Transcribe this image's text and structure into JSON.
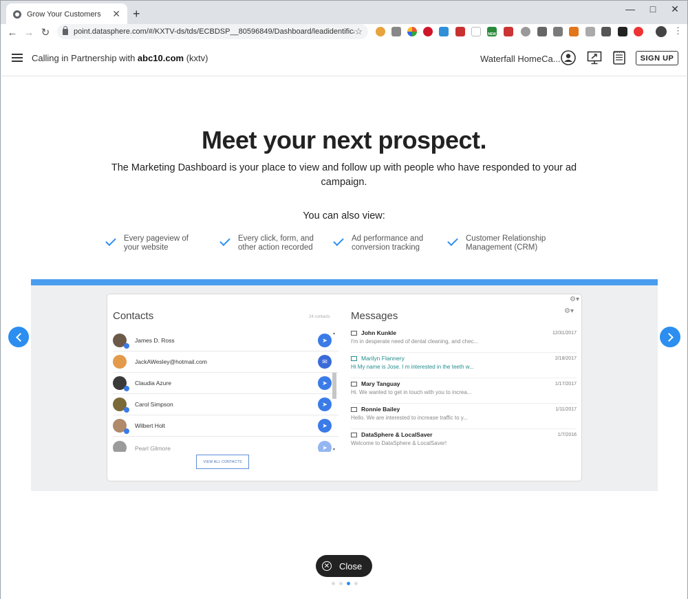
{
  "browser": {
    "tab_title": "Grow Your Customers",
    "tab_close": "✕",
    "new_tab": "+",
    "url": "point.datasphere.com/#/KXTV-ds/tds/ECBDSP__80596849/Dashboard/leadidentification",
    "extension_badge_new": "NEW"
  },
  "header": {
    "calling_prefix": "Calling in Partnership with ",
    "partner_bold": "abc10.com",
    "partner_suffix": " (kxtv)",
    "business_name": "Waterfall HomeCa...",
    "signup_label": "SIGN UP"
  },
  "hero": {
    "title": "Meet your next prospect.",
    "subtitle": "The Marketing Dashboard is your place to view and follow up with people who have responded to your ad campaign.",
    "also_label": "You can also view:",
    "features": [
      "Every pageview of your website",
      "Every click, form, and other action recorded",
      "Ad performance and conversion tracking",
      "Customer Relationship Management (CRM)"
    ]
  },
  "preview": {
    "contacts_title": "Contacts",
    "contacts_count": "24 contacts",
    "contacts": [
      {
        "name": "James D. Ross",
        "type": "messenger"
      },
      {
        "name": "JackAWesley@hotmail.com",
        "type": "email"
      },
      {
        "name": "Claudia Azure",
        "type": "messenger"
      },
      {
        "name": "Carol Simpson",
        "type": "messenger"
      },
      {
        "name": "Wilbert Holt",
        "type": "messenger"
      },
      {
        "name": "Pearl Gilmore",
        "type": "messenger"
      }
    ],
    "view_all_label": "VIEW ALL CONTACTS",
    "messages_title": "Messages",
    "messages": [
      {
        "name": "John Kunkle",
        "date": "12/31/2017",
        "preview": "I'm in desperate need of dental cleaning, and chec..."
      },
      {
        "name": "Marilyn Flannery",
        "date": "2/18/2017",
        "preview": "Hi My name is Jose. I m interested in the teeth w..."
      },
      {
        "name": "Mary Tanguay",
        "date": "1/17/2017",
        "preview": "Hi. We wanted to get in touch with you to increa..."
      },
      {
        "name": "Ronnie Bailey",
        "date": "1/11/2017",
        "preview": "Hello. We are interested to increase traffic to y..."
      },
      {
        "name": "DataSphere & LocalSaver",
        "date": "1/7/2016",
        "preview": "Welcome to DataSphere & LocalSaver!"
      }
    ]
  },
  "close_label": "Close",
  "carousel": {
    "total": 4,
    "active": 3
  },
  "colors": {
    "accent": "#2b8ef0",
    "messenger": "#3b7be8",
    "teal_name": "#238c8c"
  }
}
